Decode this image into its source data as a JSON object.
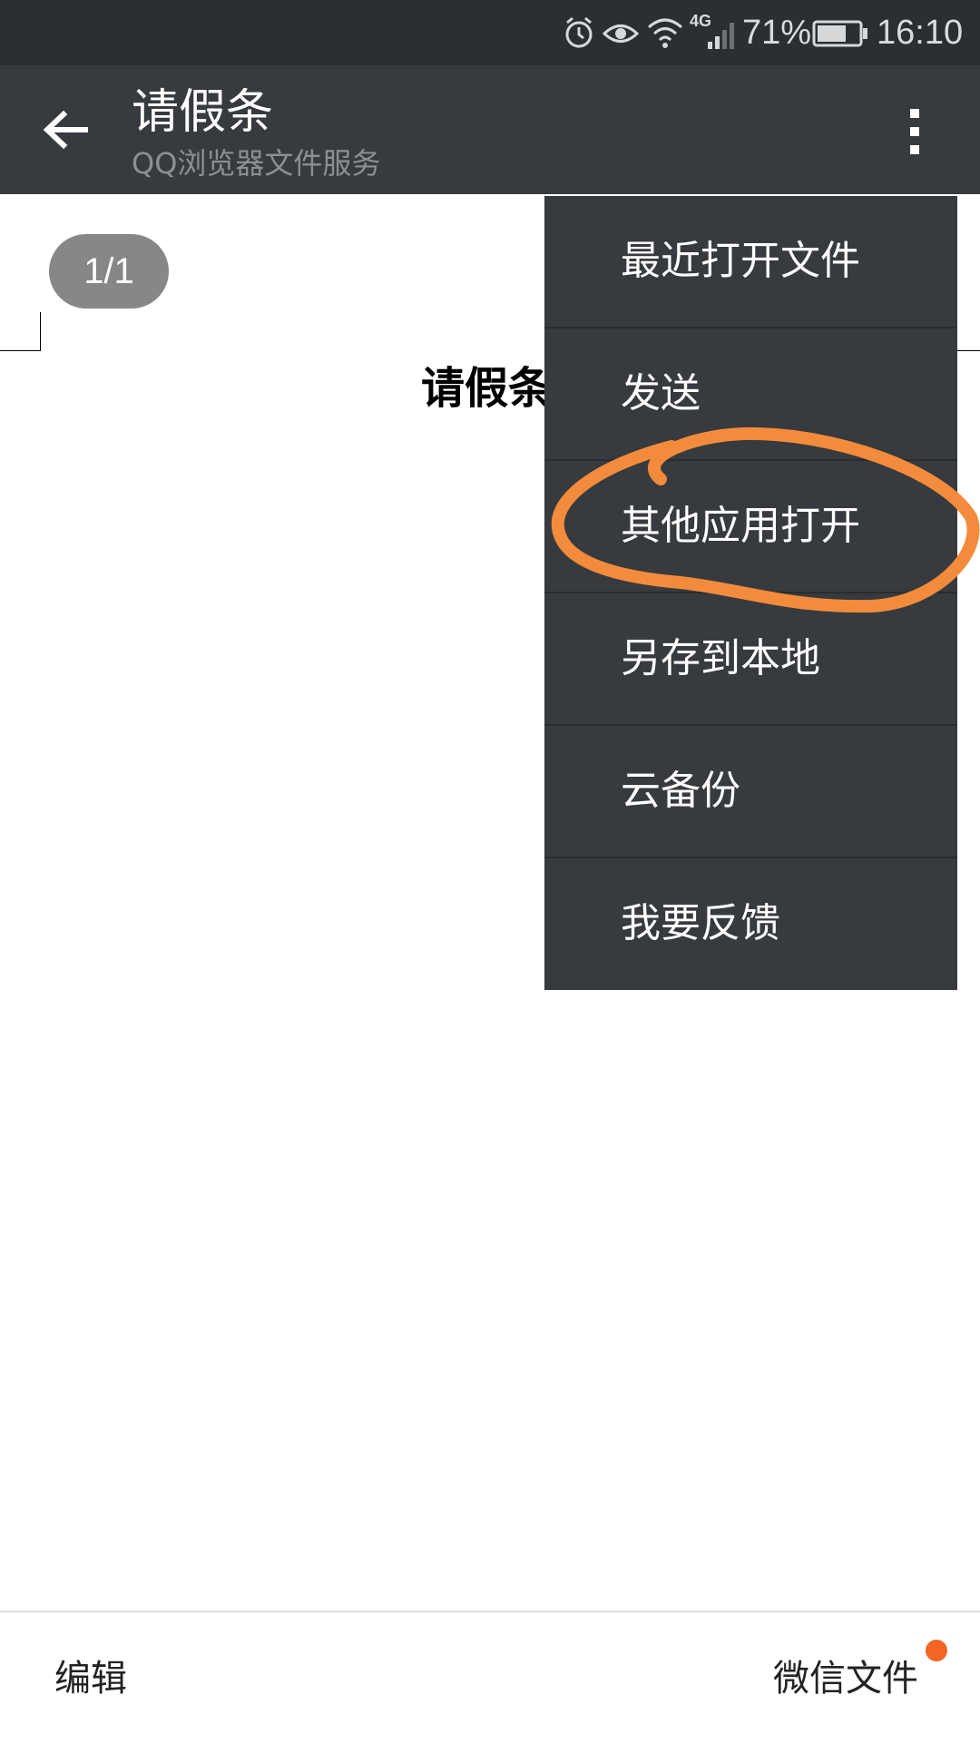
{
  "status_bar": {
    "network": "4G",
    "battery": "71%",
    "battery_level": 0.71,
    "time": "16:10",
    "icons": [
      "alarm-icon",
      "eye-icon",
      "wifi-icon",
      "signal-icon",
      "battery-icon"
    ]
  },
  "app_bar": {
    "title": "请假条",
    "subtitle": "QQ浏览器文件服务",
    "back_icon": "arrow-left-icon",
    "more_icon": "more-vertical-icon"
  },
  "document": {
    "page_indicator": "1/1",
    "title": "请假条"
  },
  "menu": {
    "items": [
      {
        "label": "最近打开文件"
      },
      {
        "label": "发送"
      },
      {
        "label": "其他应用打开"
      },
      {
        "label": "另存到本地"
      },
      {
        "label": "云备份"
      },
      {
        "label": "我要反馈"
      }
    ],
    "highlighted_item": "其他应用打开",
    "highlight_color": "#f28c3c"
  },
  "bottom_bar": {
    "edit_label": "编辑",
    "wechat_files_label": "微信文件",
    "notification_dot_color": "#f26522"
  },
  "colors": {
    "status_bar_bg": "#2b2f33",
    "app_bar_bg": "#373a3e",
    "menu_bg": "#373a3e"
  }
}
